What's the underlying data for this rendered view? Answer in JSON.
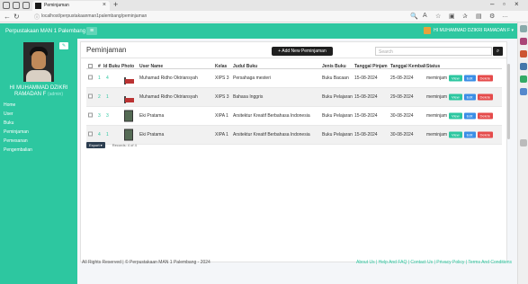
{
  "browser": {
    "tab_title": "Peminjaman",
    "url": "localhost/perpustakaanman1palembang/peminjaman"
  },
  "app": {
    "brand": "Perpustakaan MAN 1 Palembang",
    "menu_toggle": "≡",
    "user_name": "HI MUHAMMAD DZIKRI RAMADAN F ▾"
  },
  "sidebar": {
    "profile_name": "HI MUHAMMAD DZIKRI RAMADAN F",
    "profile_role": "(admin)",
    "items": [
      {
        "label": "Home"
      },
      {
        "label": "User"
      },
      {
        "label": "Buku"
      },
      {
        "label": "Peminjaman"
      },
      {
        "label": "Pemesanan"
      },
      {
        "label": "Pengembalian"
      }
    ]
  },
  "main": {
    "title": "Peminjaman",
    "add_button": "+ Add New Peminjaman",
    "search_placeholder": "Search",
    "columns": [
      "#",
      "Id Buku",
      "Photo",
      "User Name",
      "Kelas",
      "Judul Buku",
      "Jenis Buku",
      "Tanggal Pinjam",
      "Tanggal Kembali",
      "Status"
    ],
    "actions": {
      "view": "View",
      "edit": "Edit",
      "delete": "Delete"
    },
    "rows": [
      {
        "no": "1",
        "id_buku": "4",
        "user": "Muhamad Ridho Oktriansyah",
        "kelas": "XIPS 3",
        "judul": "Persahaga mesteri",
        "jenis": "Buku Bacaan",
        "pinjam": "15-08-2024",
        "kembali": "25-08-2024",
        "status": "meminjam",
        "photo": "person"
      },
      {
        "no": "2",
        "id_buku": "1",
        "user": "Muhamad Ridho Oktriansyah",
        "kelas": "XIPS 3",
        "judul": "Bahasa Inggris",
        "jenis": "Buku Pelajaran",
        "pinjam": "15-08-2024",
        "kembali": "29-08-2024",
        "status": "meminjam",
        "photo": "person"
      },
      {
        "no": "3",
        "id_buku": "3",
        "user": "Eki Pratama",
        "kelas": "XIPA 1",
        "judul": "Arsitektur Kreatif Berbahasa Indonesia",
        "jenis": "Buku Pelajaran",
        "pinjam": "15-08-2024",
        "kembali": "30-08-2024",
        "status": "meminjam",
        "photo": "book"
      },
      {
        "no": "4",
        "id_buku": "1",
        "user": "Eki Pratama",
        "kelas": "XIPA 1",
        "judul": "Arsitektur Kreatif Berbahasa Indonesia",
        "jenis": "Buku Pelajaran",
        "pinjam": "15-08-2024",
        "kembali": "30-08-2024",
        "status": "meminjam",
        "photo": "book"
      }
    ],
    "export_label": "Export ▾",
    "records_text": "Records: 4 of 4"
  },
  "footer": {
    "copyright": "All Rights Reserved | © Perpustakaan MAN 1 Palembang - 2024",
    "links": "About Us | Help And FAQ | Contact Us | Privacy Policy | Terms And Conditions"
  },
  "colors": {
    "accent": "#2dc7a0",
    "dark_button": "#1f1f1f",
    "view": "#2dc7a0",
    "edit": "#3a8ee6",
    "delete": "#e54b4b"
  }
}
